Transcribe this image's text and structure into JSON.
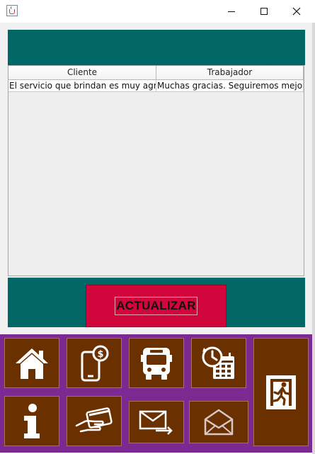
{
  "window": {
    "title": "",
    "controls": {
      "minimize": "minimize",
      "maximize": "maximize",
      "close": "close"
    }
  },
  "table": {
    "columns": [
      "Cliente",
      "Trabajador"
    ],
    "rows": [
      [
        "El servicio que brindan es muy agra...",
        "Muchas gracias. Seguiremos mejor..."
      ]
    ]
  },
  "actions": {
    "update_label": "ACTUALIZAR"
  },
  "nav": {
    "items": [
      {
        "icon": "home-icon"
      },
      {
        "icon": "mobile-payment-icon"
      },
      {
        "icon": "bus-icon"
      },
      {
        "icon": "schedule-calendar-icon"
      },
      {
        "icon": "exit-icon"
      },
      {
        "icon": "info-icon"
      },
      {
        "icon": "card-payment-icon"
      },
      {
        "icon": "send-mail-icon"
      },
      {
        "icon": "open-mail-icon"
      }
    ]
  },
  "colors": {
    "teal_band": "#006666",
    "update_button": "#d0063c",
    "nav_background": "#7a2a90",
    "nav_button": "#6b3000"
  }
}
